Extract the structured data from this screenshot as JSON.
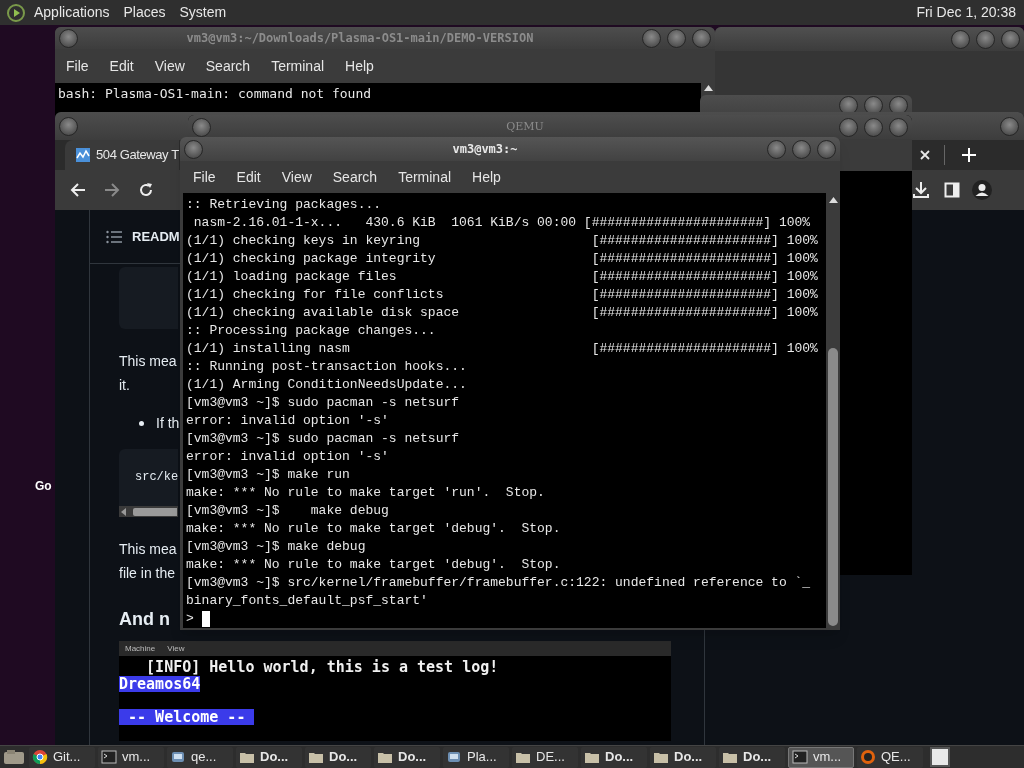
{
  "top_panel": {
    "menus": [
      "Applications",
      "Places",
      "System"
    ],
    "clock": "Fri Dec 1, 20:38"
  },
  "desktop": {
    "icon_labels": [
      "Go"
    ]
  },
  "back_terminal": {
    "title": "vm3@vm3:~/Downloads/Plasma-OS1-main/DEMO-VERSION",
    "menu": [
      "File",
      "Edit",
      "View",
      "Search",
      "Terminal",
      "Help"
    ],
    "lines": [
      "bash: Plasma-OS1-main: command not found"
    ]
  },
  "browser": {
    "tab_title": "504 Gateway T",
    "readme_header": "READM",
    "article": [
      {
        "kind": "code"
      },
      {
        "kind": "paragraph",
        "lines": [
          "This mea",
          "it."
        ]
      },
      {
        "kind": "bullet",
        "text": "If th"
      },
      {
        "kind": "code",
        "text": "src/ke"
      },
      {
        "kind": "paragraph",
        "lines": [
          "This mea",
          "file in the"
        ]
      },
      {
        "kind": "heading",
        "text": "And n"
      }
    ],
    "embedded_screenshot": {
      "menu": [
        "Machine",
        "View"
      ],
      "lines": [
        {
          "kind": "log",
          "text": "   [INFO] Hello world, this is a test log!",
          "highlighted": false
        },
        {
          "kind": "title",
          "text": "Dreamos64",
          "highlighted": true
        },
        {
          "kind": "banner",
          "text": " -- Welcome -- ",
          "highlighted": true
        }
      ]
    }
  },
  "qemu_window": {
    "title": "QEMU"
  },
  "front_terminal": {
    "title": "vm3@vm3:~",
    "menu": [
      "File",
      "Edit",
      "View",
      "Search",
      "Terminal",
      "Help"
    ],
    "cursor": true,
    "lines": [
      ":: Retrieving packages...",
      " nasm-2.16.01-1-x...   430.6 KiB  1061 KiB/s 00:00 [######################] 100%",
      "(1/1) checking keys in keyring                      [######################] 100%",
      "(1/1) checking package integrity                    [######################] 100%",
      "(1/1) loading package files                         [######################] 100%",
      "(1/1) checking for file conflicts                   [######################] 100%",
      "(1/1) checking available disk space                 [######################] 100%",
      ":: Processing package changes...",
      "(1/1) installing nasm                               [######################] 100%",
      ":: Running post-transaction hooks...",
      "(1/1) Arming ConditionNeedsUpdate...",
      "[vm3@vm3 ~]$ sudo pacman -s netsurf",
      "error: invalid option '-s'",
      "[vm3@vm3 ~]$ sudo pacman -s netsurf",
      "error: invalid option '-s'",
      "[vm3@vm3 ~]$ make run",
      "make: *** No rule to make target 'run'.  Stop.",
      "[vm3@vm3 ~]$    make debug",
      "make: *** No rule to make target 'debug'.  Stop.",
      "[vm3@vm3 ~]$ make debug",
      "make: *** No rule to make target 'debug'.  Stop.",
      "[vm3@vm3 ~]$ src/kernel/framebuffer/framebuffer.c:122: undefined reference to `_",
      "binary_fonts_default_psf_start'",
      ">"
    ]
  },
  "taskbar": {
    "items": [
      {
        "kind": "browser",
        "label": "Git...",
        "bold": false,
        "selected": false
      },
      {
        "kind": "terminal",
        "label": "vm...",
        "bold": false,
        "selected": false
      },
      {
        "kind": "emulator",
        "label": "qe...",
        "bold": false,
        "selected": false
      },
      {
        "kind": "folder",
        "label": "Do...",
        "bold": true,
        "selected": false
      },
      {
        "kind": "folder",
        "label": "Do...",
        "bold": true,
        "selected": false
      },
      {
        "kind": "folder",
        "label": "Do...",
        "bold": true,
        "selected": false
      },
      {
        "kind": "emulator",
        "label": "Pla...",
        "bold": false,
        "selected": false
      },
      {
        "kind": "folder",
        "label": "DE...",
        "bold": false,
        "selected": false
      },
      {
        "kind": "folder",
        "label": "Do...",
        "bold": true,
        "selected": false
      },
      {
        "kind": "folder",
        "label": "Do...",
        "bold": true,
        "selected": false
      },
      {
        "kind": "folder",
        "label": "Do...",
        "bold": true,
        "selected": false
      },
      {
        "kind": "terminal",
        "label": "vm...",
        "bold": false,
        "selected": true
      },
      {
        "kind": "qemu",
        "label": "QE...",
        "bold": false,
        "selected": false
      }
    ]
  }
}
